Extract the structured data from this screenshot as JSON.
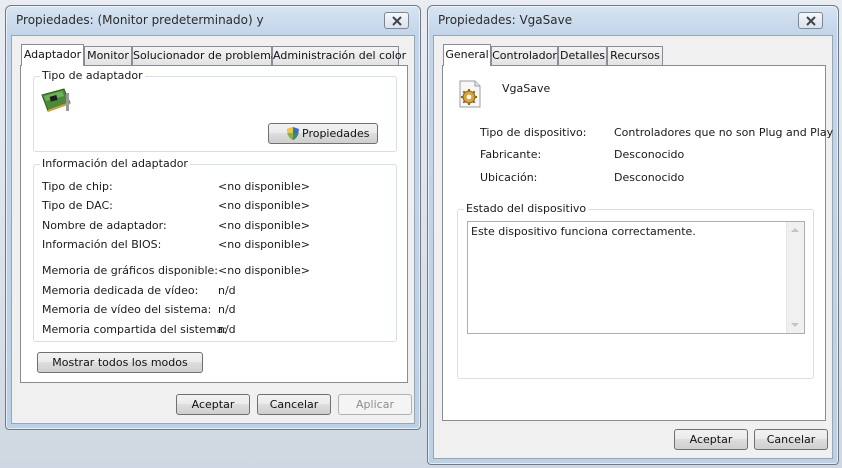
{
  "left_window": {
    "title": "Propiedades: (Monitor predeterminado) y",
    "tabs": [
      "Adaptador",
      "Monitor",
      "Solucionador de problemas",
      "Administración del color"
    ],
    "adapter_group": {
      "label": "Tipo de adaptador",
      "properties_button": "Propiedades"
    },
    "info_group": {
      "label": "Información del adaptador",
      "rows": [
        {
          "label": "Tipo de chip:",
          "value": "<no disponible>"
        },
        {
          "label": "Tipo de DAC:",
          "value": "<no disponible>"
        },
        {
          "label": "Nombre de adaptador:",
          "value": "<no disponible>"
        },
        {
          "label": "Información del BIOS:",
          "value": "<no disponible>"
        },
        {
          "label": "Memoria de gráficos disponible:",
          "value": "<no disponible>"
        },
        {
          "label": "Memoria dedicada de vídeo:",
          "value": "n/d"
        },
        {
          "label": "Memoria de vídeo del sistema:",
          "value": "n/d"
        },
        {
          "label": "Memoria compartida del sistema:",
          "value": "n/d"
        }
      ]
    },
    "list_modes_button": "Mostrar todos los modos",
    "buttons": {
      "ok": "Aceptar",
      "cancel": "Cancelar",
      "apply": "Aplicar"
    }
  },
  "right_window": {
    "title": "Propiedades: VgaSave",
    "tabs": [
      "General",
      "Controlador",
      "Detalles",
      "Recursos"
    ],
    "device_name": "VgaSave",
    "details": [
      {
        "label": "Tipo de dispositivo:",
        "value": "Controladores que no son Plug and Play"
      },
      {
        "label": "Fabricante:",
        "value": "Desconocido"
      },
      {
        "label": "Ubicación:",
        "value": "Desconocido"
      }
    ],
    "status_group": {
      "label": "Estado del dispositivo",
      "text": "Este dispositivo funciona correctamente."
    },
    "buttons": {
      "ok": "Aceptar",
      "cancel": "Cancelar"
    }
  }
}
